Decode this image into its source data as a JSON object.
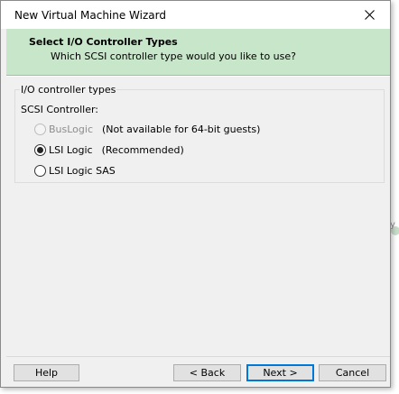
{
  "window": {
    "title": "New Virtual Machine Wizard",
    "close_icon": "close-icon"
  },
  "header": {
    "title": "Select I/O Controller Types",
    "subtitle": "Which SCSI controller type would you like to use?",
    "background_color": "#c8e6c9"
  },
  "group": {
    "legend": "I/O controller types",
    "field_label": "SCSI Controller:",
    "options": [
      {
        "label": "BusLogic",
        "note": "(Not available for 64-bit guests)",
        "selected": false,
        "enabled": false
      },
      {
        "label": "LSI Logic",
        "note": "(Recommended)",
        "selected": true,
        "enabled": true
      },
      {
        "label": "LSI Logic SAS",
        "note": "",
        "selected": false,
        "enabled": true
      }
    ]
  },
  "footer": {
    "help_label": "Help",
    "back_label": "< Back",
    "next_label": "Next >",
    "cancel_label": "Cancel",
    "default_button_color": "#0078d7"
  },
  "background_peek": {
    "glyph": "y"
  }
}
